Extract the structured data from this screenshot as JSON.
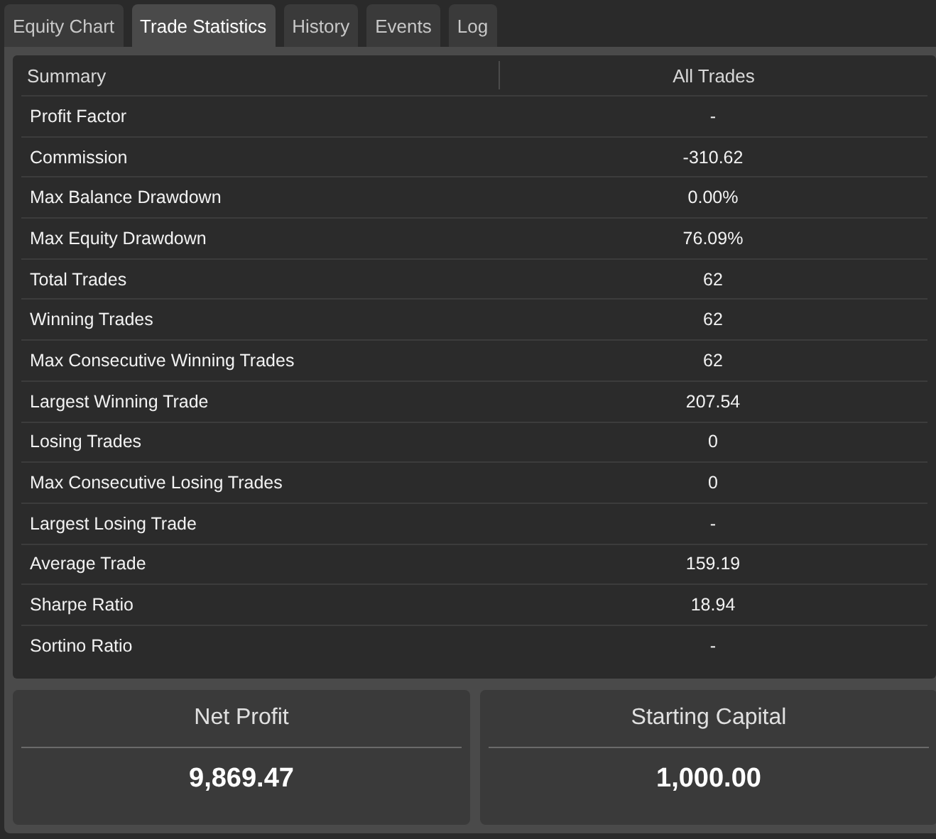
{
  "tabs": [
    {
      "label": "Equity Chart",
      "selected": false
    },
    {
      "label": "Trade Statistics",
      "selected": true
    },
    {
      "label": "History",
      "selected": false
    },
    {
      "label": "Events",
      "selected": false
    },
    {
      "label": "Log",
      "selected": false
    }
  ],
  "table": {
    "columns": [
      "Summary",
      "All Trades"
    ],
    "rows": [
      {
        "label": "Profit Factor",
        "value": "-"
      },
      {
        "label": "Commission",
        "value": "-310.62"
      },
      {
        "label": "Max Balance Drawdown",
        "value": "0.00%"
      },
      {
        "label": "Max Equity Drawdown",
        "value": "76.09%"
      },
      {
        "label": "Total Trades",
        "value": "62"
      },
      {
        "label": "Winning Trades",
        "value": "62"
      },
      {
        "label": "Max Consecutive Winning Trades",
        "value": "62"
      },
      {
        "label": "Largest Winning Trade",
        "value": "207.54"
      },
      {
        "label": "Losing Trades",
        "value": "0"
      },
      {
        "label": "Max Consecutive Losing Trades",
        "value": "0"
      },
      {
        "label": "Largest Losing Trade",
        "value": "-"
      },
      {
        "label": "Average Trade",
        "value": "159.19"
      },
      {
        "label": "Sharpe Ratio",
        "value": "18.94"
      },
      {
        "label": "Sortino Ratio",
        "value": "-"
      }
    ]
  },
  "cards": [
    {
      "title": "Net Profit",
      "value": "9,869.47"
    },
    {
      "title": "Starting Capital",
      "value": "1,000.00"
    }
  ]
}
